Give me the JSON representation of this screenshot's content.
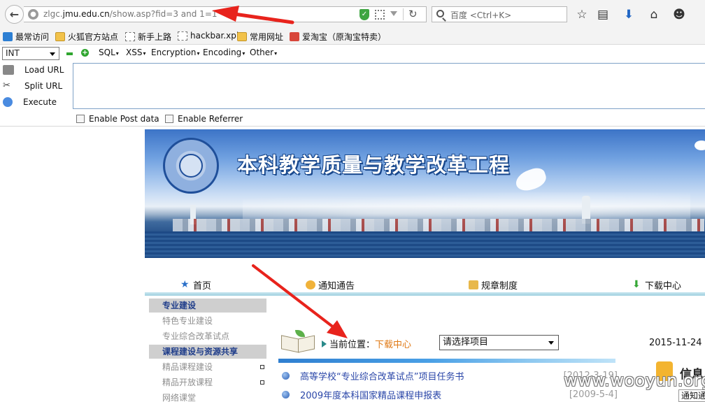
{
  "browser": {
    "url_prefix": "zlgc.",
    "url_host": "jmu.edu.cn",
    "url_path": "/show.asp?fid=3 and 1=1",
    "search_placeholder": "百度 <Ctrl+K>",
    "icons": [
      "back-icon",
      "globe-icon",
      "shield-icon",
      "qr-icon",
      "reload-icon",
      "search-icon",
      "star-icon",
      "reader-icon",
      "download-icon",
      "home-icon",
      "chat-icon"
    ]
  },
  "bookmarks": [
    {
      "label": "最常访问",
      "icon": "star"
    },
    {
      "label": "火狐官方站点",
      "icon": "folder"
    },
    {
      "label": "新手上路",
      "icon": "blank"
    },
    {
      "label": "hackbar.xpi",
      "icon": "blank"
    },
    {
      "label": "常用网址",
      "icon": "folder"
    },
    {
      "label": "爱淘宝（原淘宝特卖）",
      "icon": "red"
    }
  ],
  "hackbar": {
    "select_value": "INT",
    "menus": [
      "SQL",
      "XSS",
      "Encryption",
      "Encoding",
      "Other"
    ],
    "actions": [
      "Load URL",
      "Split URL",
      "Execute"
    ],
    "checks": [
      "Enable Post data",
      "Enable Referrer"
    ]
  },
  "site": {
    "banner_title": "本科教学质量与教学改革工程",
    "nav": [
      "首页",
      "通知通告",
      "规章制度",
      "下载中心"
    ],
    "sidebar": [
      {
        "type": "head",
        "label": "专业建设"
      },
      {
        "type": "item",
        "label": "特色专业建设"
      },
      {
        "type": "item",
        "label": "专业综合改革试点"
      },
      {
        "type": "head",
        "label": "课程建设与资源共享"
      },
      {
        "type": "item",
        "label": "精品课程建设",
        "box": true
      },
      {
        "type": "item",
        "label": "精品开放课程",
        "box": true
      },
      {
        "type": "item",
        "label": "网络课堂"
      }
    ],
    "location_label": "当前位置：",
    "location_value": "下载中心",
    "project_select": "请选择项目",
    "date": "2015-11-24",
    "news": [
      {
        "title": "高等学校“专业综合改革试点”项目任务书",
        "date": "[2012-3-19]"
      },
      {
        "title": "2009年度本科国家精品课程申报表",
        "date": "[2009-5-4]"
      }
    ],
    "info_title": "信息",
    "info_tab": "通知通"
  },
  "watermark": "www.wooyun.org",
  "colors": {
    "annotation_arrow": "#e8231c",
    "link": "#2a46a8",
    "highlight": "#e07a16",
    "sidebar_head": "#1f3d8a"
  }
}
